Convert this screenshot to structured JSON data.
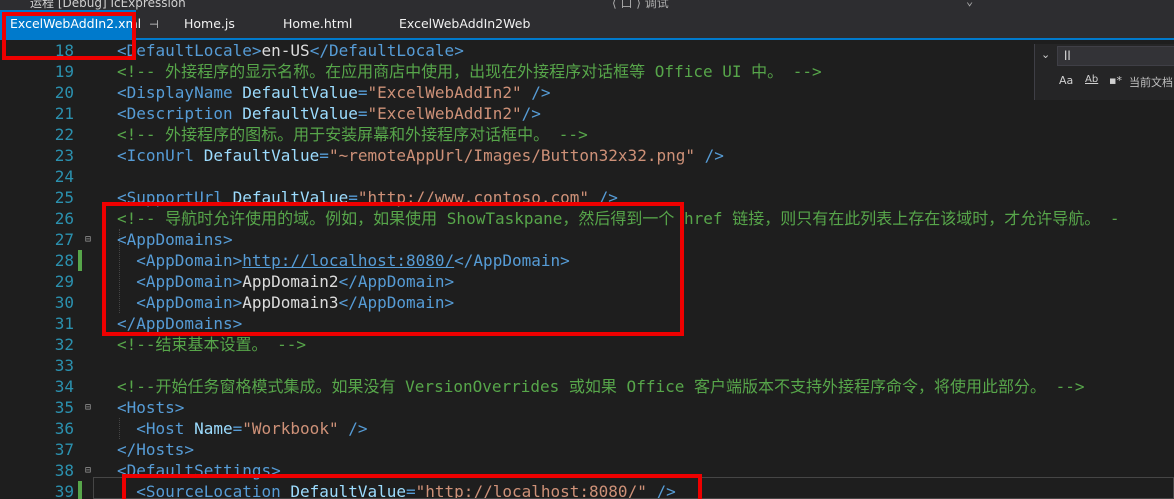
{
  "window": {
    "title_fragment": "运程 [Debug] IcExpression",
    "search_fragment": "⟨ 口 ⟩ 调试",
    "dropdown_icon": "chevron-down-icon"
  },
  "tabs": [
    {
      "label": "ExcelWebAddIn2.xml",
      "active": true,
      "pin": "⊣"
    },
    {
      "label": "Home.js",
      "active": false
    },
    {
      "label": "Home.html",
      "active": false
    },
    {
      "label": "ExcelWebAddIn2Web",
      "active": false
    }
  ],
  "find": {
    "value": "ll",
    "match_case": "Aa",
    "whole_word": "Ab",
    "regex": "▪*",
    "scope": "当前文档"
  },
  "lines": [
    {
      "n": "18",
      "tokens": [
        {
          "t": "t",
          "v": "<"
        },
        {
          "t": "t",
          "v": "DefaultLocale"
        },
        {
          "t": "t",
          "v": ">"
        },
        {
          "t": "x",
          "v": "en-US"
        },
        {
          "t": "t",
          "v": "</"
        },
        {
          "t": "t",
          "v": "DefaultLocale"
        },
        {
          "t": "t",
          "v": ">"
        }
      ]
    },
    {
      "n": "19",
      "tokens": [
        {
          "t": "c",
          "v": "<!-- 外接程序的显示名称。在应用商店中使用，出现在外接程序对话框等 Office UI 中。 -->"
        }
      ]
    },
    {
      "n": "20",
      "tokens": [
        {
          "t": "t",
          "v": "<DisplayName"
        },
        {
          "t": "x",
          "v": " "
        },
        {
          "t": "a",
          "v": "DefaultValue"
        },
        {
          "t": "t",
          "v": "="
        },
        {
          "t": "s",
          "v": "\"ExcelWebAddIn2\""
        },
        {
          "t": "x",
          "v": " "
        },
        {
          "t": "t",
          "v": "/>"
        }
      ]
    },
    {
      "n": "21",
      "tokens": [
        {
          "t": "t",
          "v": "<Description"
        },
        {
          "t": "x",
          "v": " "
        },
        {
          "t": "a",
          "v": "DefaultValue"
        },
        {
          "t": "t",
          "v": "="
        },
        {
          "t": "s",
          "v": "\"ExcelWebAddIn2\""
        },
        {
          "t": "t",
          "v": "/>"
        }
      ]
    },
    {
      "n": "22",
      "tokens": [
        {
          "t": "c",
          "v": "<!-- 外接程序的图标。用于安装屏幕和外接程序对话框中。 -->"
        }
      ]
    },
    {
      "n": "23",
      "tokens": [
        {
          "t": "t",
          "v": "<IconUrl"
        },
        {
          "t": "x",
          "v": " "
        },
        {
          "t": "a",
          "v": "DefaultValue"
        },
        {
          "t": "t",
          "v": "="
        },
        {
          "t": "s",
          "v": "\"~remoteAppUrl/Images/Button32x32.png\""
        },
        {
          "t": "x",
          "v": " "
        },
        {
          "t": "t",
          "v": "/>"
        }
      ]
    },
    {
      "n": "24",
      "tokens": []
    },
    {
      "n": "25",
      "tokens": [
        {
          "t": "t",
          "v": "<SupportUrl"
        },
        {
          "t": "x",
          "v": " "
        },
        {
          "t": "a",
          "v": "DefaultValue"
        },
        {
          "t": "t",
          "v": "="
        },
        {
          "t": "s",
          "v": "\"http://www.contoso.com\""
        },
        {
          "t": "x",
          "v": " "
        },
        {
          "t": "t",
          "v": "/>"
        }
      ]
    },
    {
      "n": "26",
      "tokens": [
        {
          "t": "c",
          "v": "<!-- 导航时允许使用的域。例如，如果使用 ShowTaskpane，然后得到一个 href 链接，则只有在此列表上存在该域时，才允许导航。 -"
        }
      ]
    },
    {
      "n": "27",
      "fold": "⊟",
      "tokens": [
        {
          "t": "t",
          "v": "<AppDomains>"
        }
      ]
    },
    {
      "n": "28",
      "changed": true,
      "tokens": [
        {
          "t": "x",
          "v": "  "
        },
        {
          "t": "t",
          "v": "<AppDomain>"
        },
        {
          "t": "u",
          "v": "http://localhost:8080/"
        },
        {
          "t": "t",
          "v": "</AppDomain>"
        }
      ]
    },
    {
      "n": "29",
      "tokens": [
        {
          "t": "x",
          "v": "  "
        },
        {
          "t": "t",
          "v": "<AppDomain>"
        },
        {
          "t": "x",
          "v": "AppDomain2"
        },
        {
          "t": "t",
          "v": "</AppDomain>"
        }
      ]
    },
    {
      "n": "30",
      "tokens": [
        {
          "t": "x",
          "v": "  "
        },
        {
          "t": "t",
          "v": "<AppDomain>"
        },
        {
          "t": "x",
          "v": "AppDomain3"
        },
        {
          "t": "t",
          "v": "</AppDomain>"
        }
      ]
    },
    {
      "n": "31",
      "tokens": [
        {
          "t": "t",
          "v": "</AppDomains>"
        }
      ]
    },
    {
      "n": "32",
      "tokens": [
        {
          "t": "c",
          "v": "<!--结束基本设置。 -->"
        }
      ]
    },
    {
      "n": "33",
      "tokens": []
    },
    {
      "n": "34",
      "tokens": [
        {
          "t": "c",
          "v": "<!--开始任务窗格模式集成。如果没有 VersionOverrides 或如果 Office 客户端版本不支持外接程序命令，将使用此部分。 -->"
        }
      ]
    },
    {
      "n": "35",
      "fold": "⊟",
      "tokens": [
        {
          "t": "t",
          "v": "<Hosts>"
        }
      ]
    },
    {
      "n": "36",
      "tokens": [
        {
          "t": "x",
          "v": "  "
        },
        {
          "t": "t",
          "v": "<Host"
        },
        {
          "t": "x",
          "v": " "
        },
        {
          "t": "a",
          "v": "Name"
        },
        {
          "t": "t",
          "v": "="
        },
        {
          "t": "s",
          "v": "\"Workbook\""
        },
        {
          "t": "x",
          "v": " "
        },
        {
          "t": "t",
          "v": "/>"
        }
      ]
    },
    {
      "n": "37",
      "tokens": [
        {
          "t": "t",
          "v": "</Hosts>"
        }
      ]
    },
    {
      "n": "38",
      "fold": "⊟",
      "tokens": [
        {
          "t": "t",
          "v": "<DefaultSettings>"
        }
      ]
    },
    {
      "n": "39",
      "changed": true,
      "tokens": [
        {
          "t": "x",
          "v": "  "
        },
        {
          "t": "t",
          "v": "<SourceLocation"
        },
        {
          "t": "x",
          "v": " "
        },
        {
          "t": "a",
          "v": "DefaultValue"
        },
        {
          "t": "t",
          "v": "="
        },
        {
          "t": "s",
          "v": "\"http://localhost:8080/\""
        },
        {
          "t": "x",
          "v": " "
        },
        {
          "t": "t",
          "v": "/>"
        }
      ]
    }
  ],
  "colors": {
    "tag": "#569cd6",
    "attribute": "#9cdcfe",
    "string": "#ce9178",
    "comment": "#57a64a",
    "text": "#dcdcdc",
    "line_number": "#2b91af",
    "highlight_box": "#ee0000",
    "active_tab": "#007acc"
  }
}
